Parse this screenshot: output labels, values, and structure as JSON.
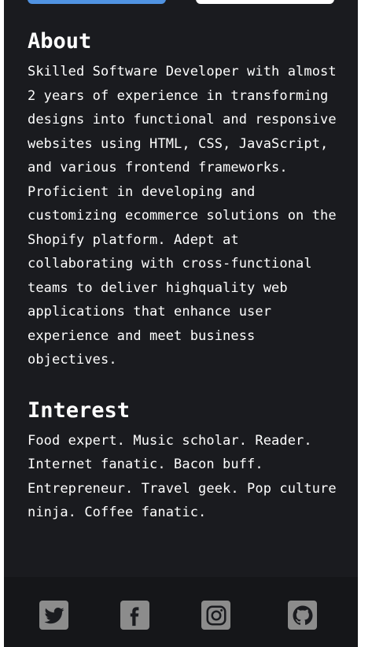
{
  "about": {
    "title": "About",
    "text": "Skilled Software Developer with almost 2 years of experience in transforming designs into functional and responsive websites using HTML, CSS, JavaScript, and various frontend frameworks. Proficient in developing and customizing ecommerce solutions on the Shopify platform. Adept at collaborating with cross-functional teams to deliver highquality web applications that enhance user experience and meet business objectives."
  },
  "interest": {
    "title": "Interest",
    "text": "Food expert. Music scholar. Reader. Internet fanatic. Bacon buff. Entrepreneur. Travel geek. Pop culture ninja. Coffee fanatic."
  },
  "footer": {
    "links": [
      {
        "name": "twitter",
        "icon": "twitter-icon"
      },
      {
        "name": "facebook",
        "icon": "facebook-icon"
      },
      {
        "name": "instagram",
        "icon": "instagram-icon"
      },
      {
        "name": "github",
        "icon": "github-icon"
      }
    ]
  },
  "colors": {
    "card_background": "#1a1b1f",
    "footer_background": "#151619",
    "icon_background": "#8c8c8c",
    "icon_foreground": "#1a1b1f",
    "accent": "#5093e2"
  }
}
